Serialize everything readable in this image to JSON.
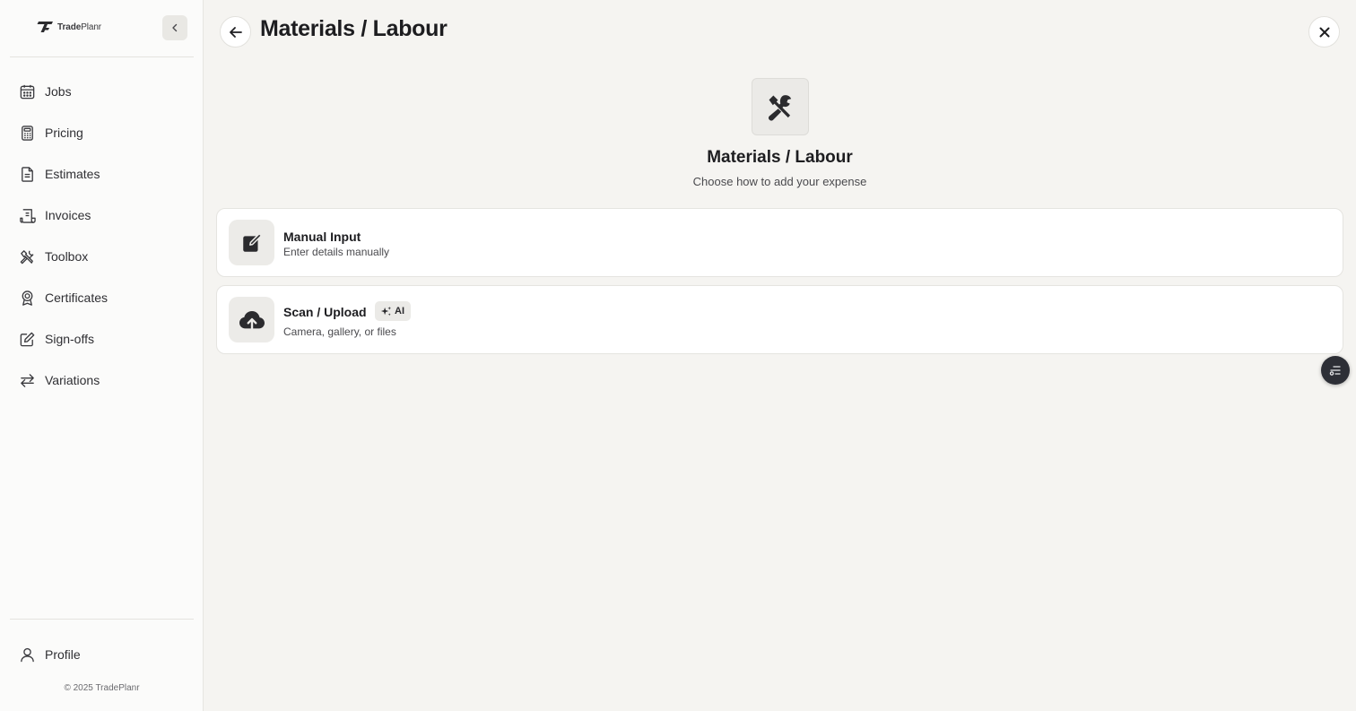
{
  "brand": {
    "name_bold": "Trade",
    "name_light": "Planr"
  },
  "sidebar": {
    "items": [
      {
        "label": "Jobs",
        "icon": "calendar-icon"
      },
      {
        "label": "Pricing",
        "icon": "calculator-icon"
      },
      {
        "label": "Estimates",
        "icon": "document-icon"
      },
      {
        "label": "Invoices",
        "icon": "receipt-icon"
      },
      {
        "label": "Toolbox",
        "icon": "tools-icon"
      },
      {
        "label": "Certificates",
        "icon": "award-icon"
      },
      {
        "label": "Sign-offs",
        "icon": "pen-square-icon"
      },
      {
        "label": "Variations",
        "icon": "swap-arrows-icon"
      }
    ],
    "profile_label": "Profile",
    "copyright": "© 2025 TradePlanr"
  },
  "header": {
    "title": "Materials / Labour"
  },
  "hero": {
    "title": "Materials / Labour",
    "subtitle": "Choose how to add your expense"
  },
  "options": [
    {
      "title": "Manual Input",
      "description": "Enter details manually",
      "icon": "edit-icon"
    },
    {
      "title": "Scan / Upload",
      "description": "Camera, gallery, or files",
      "icon": "cloud-upload-icon",
      "badge": "AI"
    }
  ]
}
